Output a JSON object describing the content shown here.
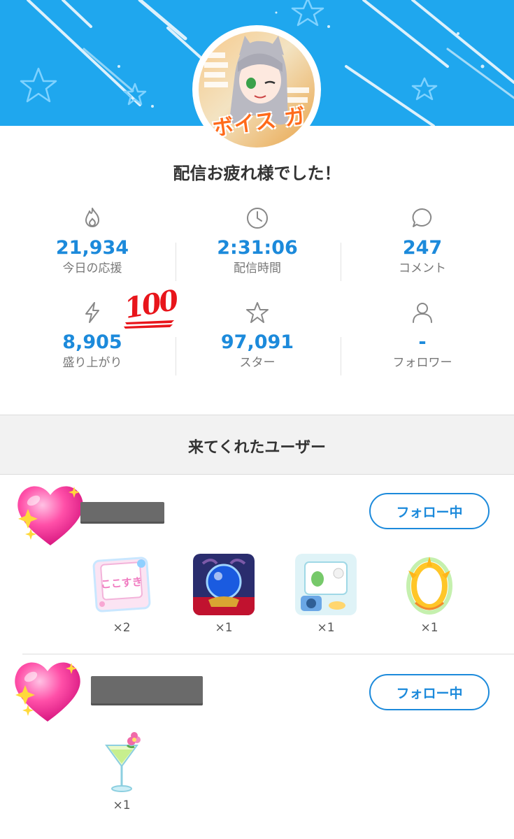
{
  "summary": {
    "title": "配信お疲れ様でした！",
    "avatar_text": "ボイス ガチャ",
    "stats": [
      {
        "icon": "fire-icon",
        "value": "21,934",
        "label": "今日の応援"
      },
      {
        "icon": "clock-icon",
        "value": "2:31:06",
        "label": "配信時間"
      },
      {
        "icon": "chat-bubble-icon",
        "value": "247",
        "label": "コメント"
      },
      {
        "icon": "lightning-icon",
        "value": "8,905",
        "label": "盛り上がり"
      },
      {
        "icon": "star-icon",
        "value": "97,091",
        "label": "スター"
      },
      {
        "icon": "person-icon",
        "value": "-",
        "label": "フォロワー"
      }
    ],
    "emoji_sticker": "100"
  },
  "visitors": {
    "section_title": "来てくれたユーザー",
    "users": [
      {
        "follow_label": "フォロー中",
        "gifts": [
          {
            "icon": "kokosuki-card-icon",
            "image_text": "ここすき",
            "count": "×2"
          },
          {
            "icon": "crystal-ball-icon",
            "count": "×1"
          },
          {
            "icon": "frog-camera-icon",
            "count": "×1"
          },
          {
            "icon": "golden-aura-icon",
            "count": "×1"
          }
        ]
      },
      {
        "follow_label": "フォロー中",
        "gifts": [
          {
            "icon": "cocktail-icon",
            "count": "×1"
          }
        ]
      }
    ]
  },
  "colors": {
    "header": "#1fa7ee",
    "accent": "#1c8adb",
    "heart": "#ff4fa8",
    "sticker_red": "#e8151b"
  }
}
